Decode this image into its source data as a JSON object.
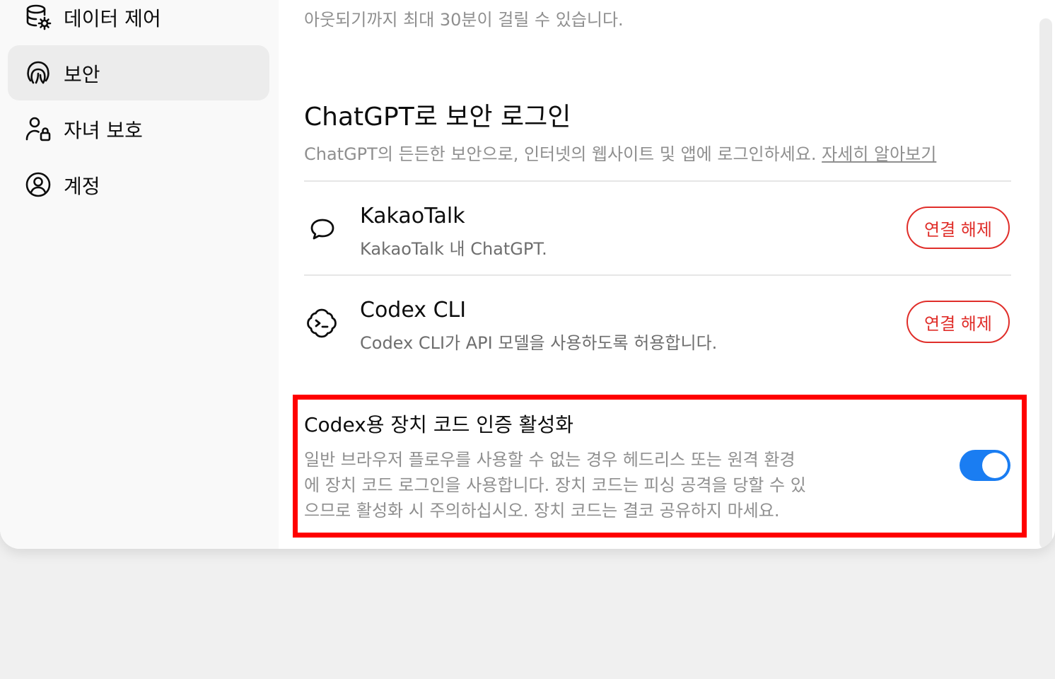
{
  "sidebar": {
    "items": [
      {
        "label": "데이터 제어",
        "icon": "database-gear-icon",
        "active": false
      },
      {
        "label": "보안",
        "icon": "fingerprint-icon",
        "active": true
      },
      {
        "label": "자녀 보호",
        "icon": "parent-lock-icon",
        "active": false
      },
      {
        "label": "계정",
        "icon": "account-circle-icon",
        "active": false
      }
    ]
  },
  "top_note": "아웃되기까지 최대 30분이 걸릴 수 있습니다.",
  "secure_login": {
    "title": "ChatGPT로 보안 로그인",
    "description": "ChatGPT의 든든한 보안으로, 인터넷의 웹사이트 및 앱에 로그인하세요.",
    "learn_more": "자세히 알아보기"
  },
  "connections": [
    {
      "name": "KakaoTalk",
      "description": "KakaoTalk 내 ChatGPT.",
      "icon": "chat-bubble-icon",
      "button": "연결 해제"
    },
    {
      "name": "Codex CLI",
      "description": "Codex CLI가 API 모델을 사용하도록 허용합니다.",
      "icon": "codex-cli-icon",
      "button": "연결 해제"
    }
  ],
  "device_code": {
    "title": "Codex용 장치 코드 인증 활성화",
    "description_lines": [
      "일반 브라우저 플로우를 사용할 수 없는 경우 헤드리스 또는 원격 환경",
      "에 장치 코드 로그인을 사용합니다. 장치 코드는 피싱 공격을 당할 수 있",
      "으므로 활성화 시 주의하십시오. 장치 코드는 결코 공유하지 마세요."
    ],
    "enabled": true
  },
  "colors": {
    "accent_toggle": "#1a7df2",
    "danger": "#e02e2a",
    "highlight": "#ff0000"
  }
}
